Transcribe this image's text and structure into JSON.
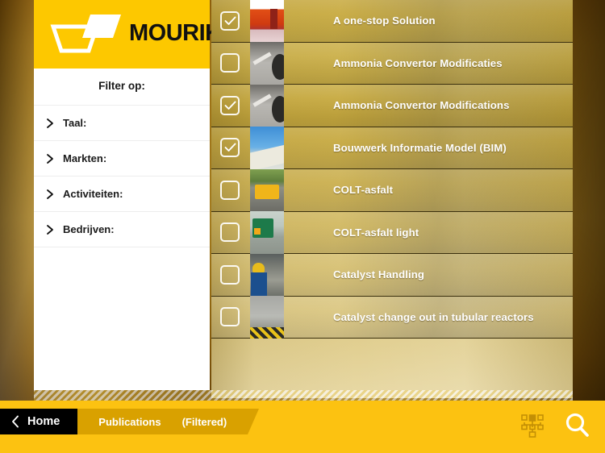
{
  "brand": {
    "name": "MOURIK",
    "logo_icon": "mourik-trapezoid-logo",
    "header_color": "#fdc800"
  },
  "sidebar": {
    "title": "Filter op:",
    "items": [
      {
        "label": "Taal:",
        "icon": "chevron-right-icon"
      },
      {
        "label": "Markten:",
        "icon": "chevron-right-icon"
      },
      {
        "label": "Activiteiten:",
        "icon": "chevron-right-icon"
      },
      {
        "label": "Bedrijven:",
        "icon": "chevron-right-icon"
      }
    ]
  },
  "list": {
    "rows": [
      {
        "title": "A one-stop Solution",
        "checked": true,
        "thumb": "t-onestop",
        "thumb_icon": "publication-thumbnail"
      },
      {
        "title": "Ammonia Convertor Modificaties",
        "checked": false,
        "thumb": "t-ammonia",
        "thumb_icon": "publication-thumbnail"
      },
      {
        "title": "Ammonia Convertor Modifications",
        "checked": true,
        "thumb": "t-ammonia",
        "thumb_icon": "publication-thumbnail"
      },
      {
        "title": "Bouwwerk Informatie Model (BIM)",
        "checked": true,
        "thumb": "t-bim",
        "thumb_icon": "publication-thumbnail"
      },
      {
        "title": "COLT-asfalt",
        "checked": false,
        "thumb": "t-colt",
        "thumb_icon": "publication-thumbnail"
      },
      {
        "title": "COLT-asfalt light",
        "checked": false,
        "thumb": "t-coltlight",
        "thumb_icon": "publication-thumbnail"
      },
      {
        "title": "Catalyst Handling",
        "checked": false,
        "thumb": "t-catalyst",
        "thumb_icon": "publication-thumbnail"
      },
      {
        "title": "Catalyst change out in tubular reactors",
        "checked": false,
        "thumb": "t-tubular",
        "thumb_icon": "publication-thumbnail"
      }
    ]
  },
  "bottom_bar": {
    "home_label": "Home",
    "home_icon": "chevron-left-icon",
    "crumbs": [
      {
        "label": "Publications"
      },
      {
        "label": "(Filtered)"
      }
    ],
    "icons": [
      {
        "name": "sitemap-icon"
      },
      {
        "name": "search-icon"
      }
    ],
    "bar_color": "#fcc211",
    "crumb_color": "#d9a100"
  }
}
